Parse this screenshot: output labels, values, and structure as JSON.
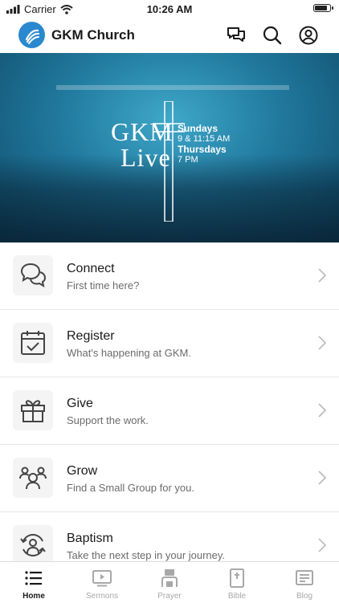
{
  "status_bar": {
    "carrier": "Carrier",
    "time": "10:26 AM",
    "battery_level": 0.9
  },
  "header": {
    "title": "GKM Church"
  },
  "hero": {
    "brand_line1": "GKM",
    "brand_line2": "Live",
    "day1": "Sundays",
    "time1": "9 & 11:15 AM",
    "day2": "Thursdays",
    "time2": "7 PM",
    "slide_count": 3,
    "active_slide": 0
  },
  "items": [
    {
      "title": "Connect",
      "subtitle": "First time here?",
      "icon": "chat-bubbles-icon"
    },
    {
      "title": "Register",
      "subtitle": "What's happening at GKM.",
      "icon": "calendar-check-icon"
    },
    {
      "title": "Give",
      "subtitle": "Support the work.",
      "icon": "gift-icon"
    },
    {
      "title": "Grow",
      "subtitle": "Find a Small Group for you.",
      "icon": "group-icon"
    },
    {
      "title": "Baptism",
      "subtitle": "Take the next step in your journey.",
      "icon": "baptism-icon"
    }
  ],
  "tabs": [
    {
      "label": "Home",
      "icon": "list-icon",
      "active": true
    },
    {
      "label": "Sermons",
      "icon": "video-icon",
      "active": false
    },
    {
      "label": "Prayer",
      "icon": "prayer-icon",
      "active": false
    },
    {
      "label": "Bible",
      "icon": "bible-icon",
      "active": false
    },
    {
      "label": "Blog",
      "icon": "blog-icon",
      "active": false
    }
  ],
  "colors": {
    "brand": "#2a88cf",
    "hero": "#217a9f",
    "text": "#1a1a1a",
    "muted": "#6b6b6b",
    "inactive_tab": "#a8a8a8"
  }
}
